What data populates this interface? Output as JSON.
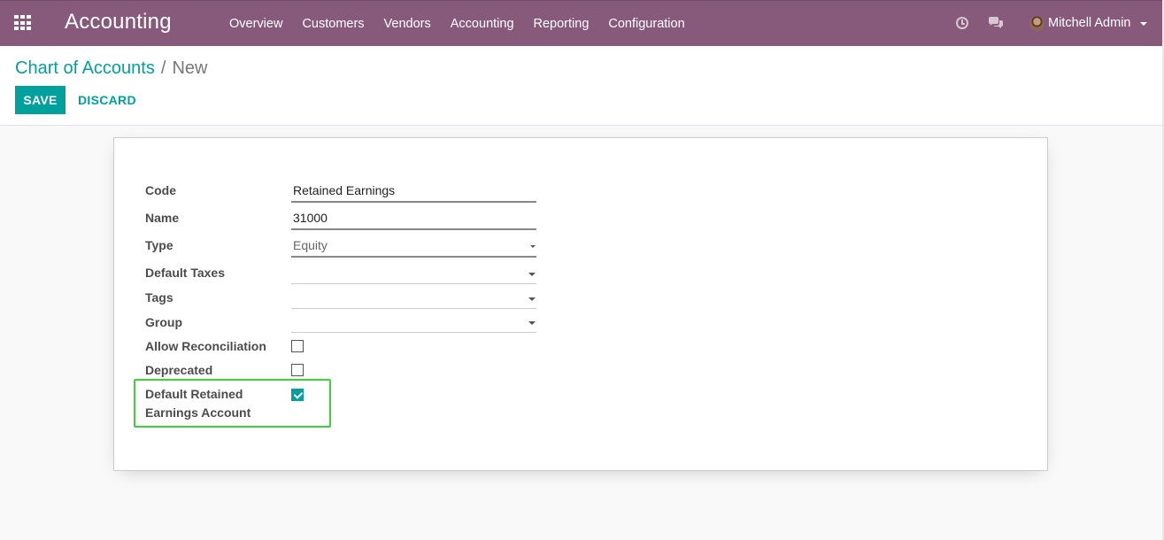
{
  "navbar": {
    "brand": "Accounting",
    "menu": [
      "Overview",
      "Customers",
      "Vendors",
      "Accounting",
      "Reporting",
      "Configuration"
    ],
    "user": "Mitchell Admin",
    "icons": [
      "apps-icon",
      "clock-icon",
      "chat-icon"
    ],
    "bg_color": "#875a7b"
  },
  "breadcrumb": {
    "parent": "Chart of Accounts",
    "separator": "/",
    "current": "New"
  },
  "actions": {
    "save": "SAVE",
    "discard": "DISCARD"
  },
  "form": {
    "code_label": "Code",
    "code_value": "Retained Earnings",
    "name_label": "Name",
    "name_value": "31000",
    "type_label": "Type",
    "type_value": "Equity",
    "taxes_label": "Default Taxes",
    "tags_label": "Tags",
    "group_label": "Group",
    "reconcile_label": "Allow Reconciliation",
    "reconcile_checked": false,
    "deprecated_label": "Deprecated",
    "deprecated_checked": false,
    "retained_label_1": "Default Retained",
    "retained_label_2": "Earnings Account",
    "retained_checked": true
  },
  "colors": {
    "accent": "#00a09d",
    "highlight": "#3ed13a"
  }
}
